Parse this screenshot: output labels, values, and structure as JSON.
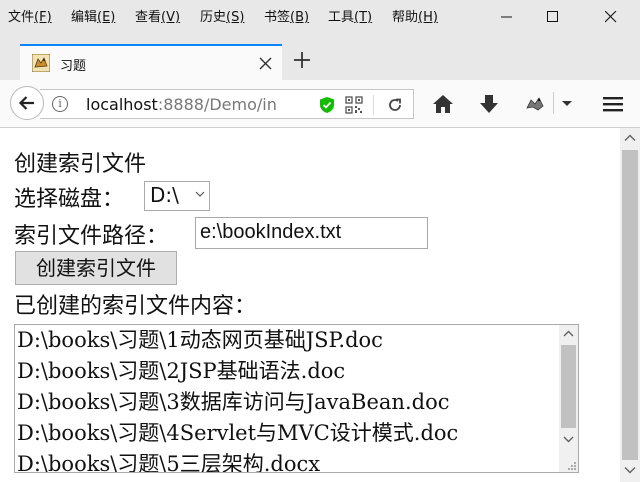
{
  "menubar": {
    "items": [
      {
        "label": "文件",
        "accel": "(F)"
      },
      {
        "label": "编辑",
        "accel": "(E)"
      },
      {
        "label": "查看",
        "accel": "(V)"
      },
      {
        "label": "历史",
        "accel": "(S)"
      },
      {
        "label": "书签",
        "accel": "(B)"
      },
      {
        "label": "工具",
        "accel": "(T)"
      },
      {
        "label": "帮助",
        "accel": "(H)"
      }
    ]
  },
  "window_controls": {
    "minimize": "—",
    "maximize": "☐",
    "close": "✕"
  },
  "tab": {
    "title": "习题",
    "close": "✕"
  },
  "newtab": {
    "label": "+"
  },
  "toolbar": {
    "url_host": "localhost",
    "url_rest": ":8888/Demo/in",
    "icons": [
      "back-arrow-icon",
      "info-icon",
      "tracking-shield-icon",
      "qr-code-icon",
      "reload-icon",
      "home-icon",
      "download-icon",
      "extension-icon",
      "chevron-down-icon",
      "hamburger-menu-icon"
    ]
  },
  "page": {
    "heading": "创建索引文件",
    "disk_label": "选择磁盘：",
    "disk_value": "D:\\",
    "path_label": "索引文件路径：",
    "path_value": "e:\\bookIndex.txt",
    "create_button": "创建索引文件",
    "content_label": "已创建的索引文件内容：",
    "content_lines": [
      "D:\\books\\习题\\1动态网页基础JSP.doc",
      "D:\\books\\习题\\2JSP基础语法.doc",
      "D:\\books\\习题\\3数据库访问与JavaBean.doc",
      "D:\\books\\习题\\4Servlet与MVC设计模式.doc",
      "D:\\books\\习题\\5三层架构.docx"
    ]
  },
  "colors": {
    "accent": "#0a84ff",
    "chrome": "#e8e8e8",
    "toolbar": "#fafafa",
    "shield": "#12bc00"
  }
}
